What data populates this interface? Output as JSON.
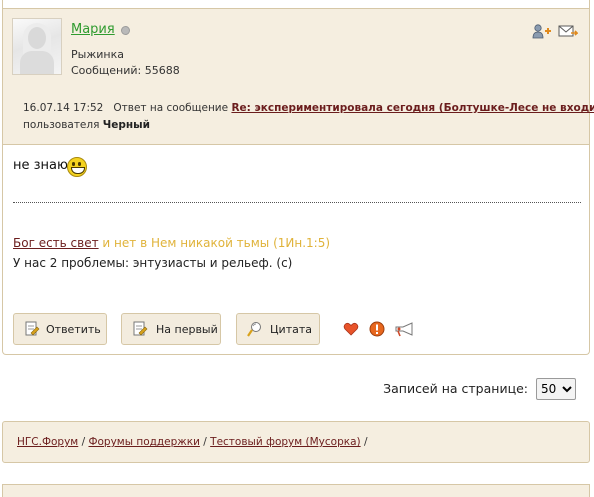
{
  "post": {
    "author": {
      "name": "Мария",
      "title": "Рыжинка",
      "posts_label": "Сообщений:",
      "posts_count": "55688",
      "status": "offline"
    },
    "header_icons": [
      "add-friend-icon",
      "send-message-icon"
    ],
    "meta": {
      "datetime": "16.07.14 17:52",
      "reply_prefix": "Ответ на сообщение",
      "reply_link": "Re: экспериментировала сегодня (Болтушке-Лесе не входить!)",
      "by_user_prefix": "пользователя",
      "by_user": "Черный"
    },
    "message": "не знаю",
    "signature": {
      "link": "Бог есть свет",
      "quote": "и нет в Нем никакой тьмы (1Ин.1:5)",
      "line2": "У нас 2 проблемы: энтузиасты и рельеф. (с)"
    },
    "buttons": {
      "reply": "Ответить",
      "first": "На первый",
      "quote": "Цитата"
    },
    "action_icons": [
      "heart-icon",
      "warning-icon",
      "megaphone-icon"
    ]
  },
  "pager": {
    "label": "Записей на странице:",
    "selected": "50"
  },
  "breadcrumbs": {
    "items": [
      "НГС.Форум",
      "Форумы поддержки",
      "Тестовый форум (Мусорка)"
    ],
    "separator": "/"
  },
  "colors": {
    "header_bg": "#f5eee0",
    "border": "#d6c7a6",
    "username": "#2f9b2f",
    "link": "#6b1d1d",
    "quote": "#e0b33a"
  }
}
